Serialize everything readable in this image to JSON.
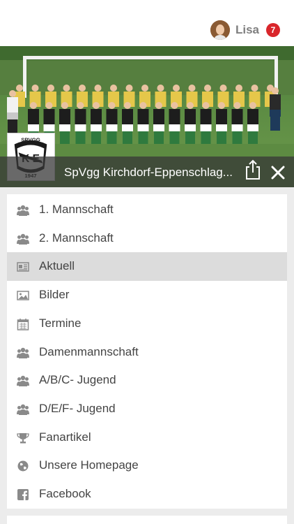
{
  "header": {
    "user_name": "Lisa",
    "notification_count": "7",
    "avatar_icon": "user-avatar",
    "badge_color": "#d9262b"
  },
  "hero": {
    "club_name": "SpVgg Kirchdorf-Eppenschlag...",
    "logo_top_text": "SPVGG",
    "logo_year": "1947",
    "logo_letters": "K E",
    "share_icon": "share-icon",
    "close_icon": "close-icon"
  },
  "menu": {
    "items": [
      {
        "label": "1. Mannschaft",
        "icon": "team-icon"
      },
      {
        "label": "2.  Mannschaft",
        "icon": "team-icon"
      },
      {
        "label": "Aktuell",
        "icon": "news-icon",
        "active": true
      },
      {
        "label": "Bilder",
        "icon": "image-icon"
      },
      {
        "label": "Termine",
        "icon": "calendar-icon"
      },
      {
        "label": "Damenmannschaft",
        "icon": "team-icon"
      },
      {
        "label": "A/B/C- Jugend",
        "icon": "team-icon"
      },
      {
        "label": "D/E/F- Jugend",
        "icon": "team-icon"
      },
      {
        "label": "Fanartikel",
        "icon": "trophy-icon"
      },
      {
        "label": "Unsere Homepage",
        "icon": "globe-icon"
      },
      {
        "label": "Facebook",
        "icon": "facebook-icon"
      }
    ]
  },
  "colors": {
    "active_row": "#dcdcdc",
    "menu_text": "#444444",
    "icon_gray": "#8a8a8a"
  }
}
